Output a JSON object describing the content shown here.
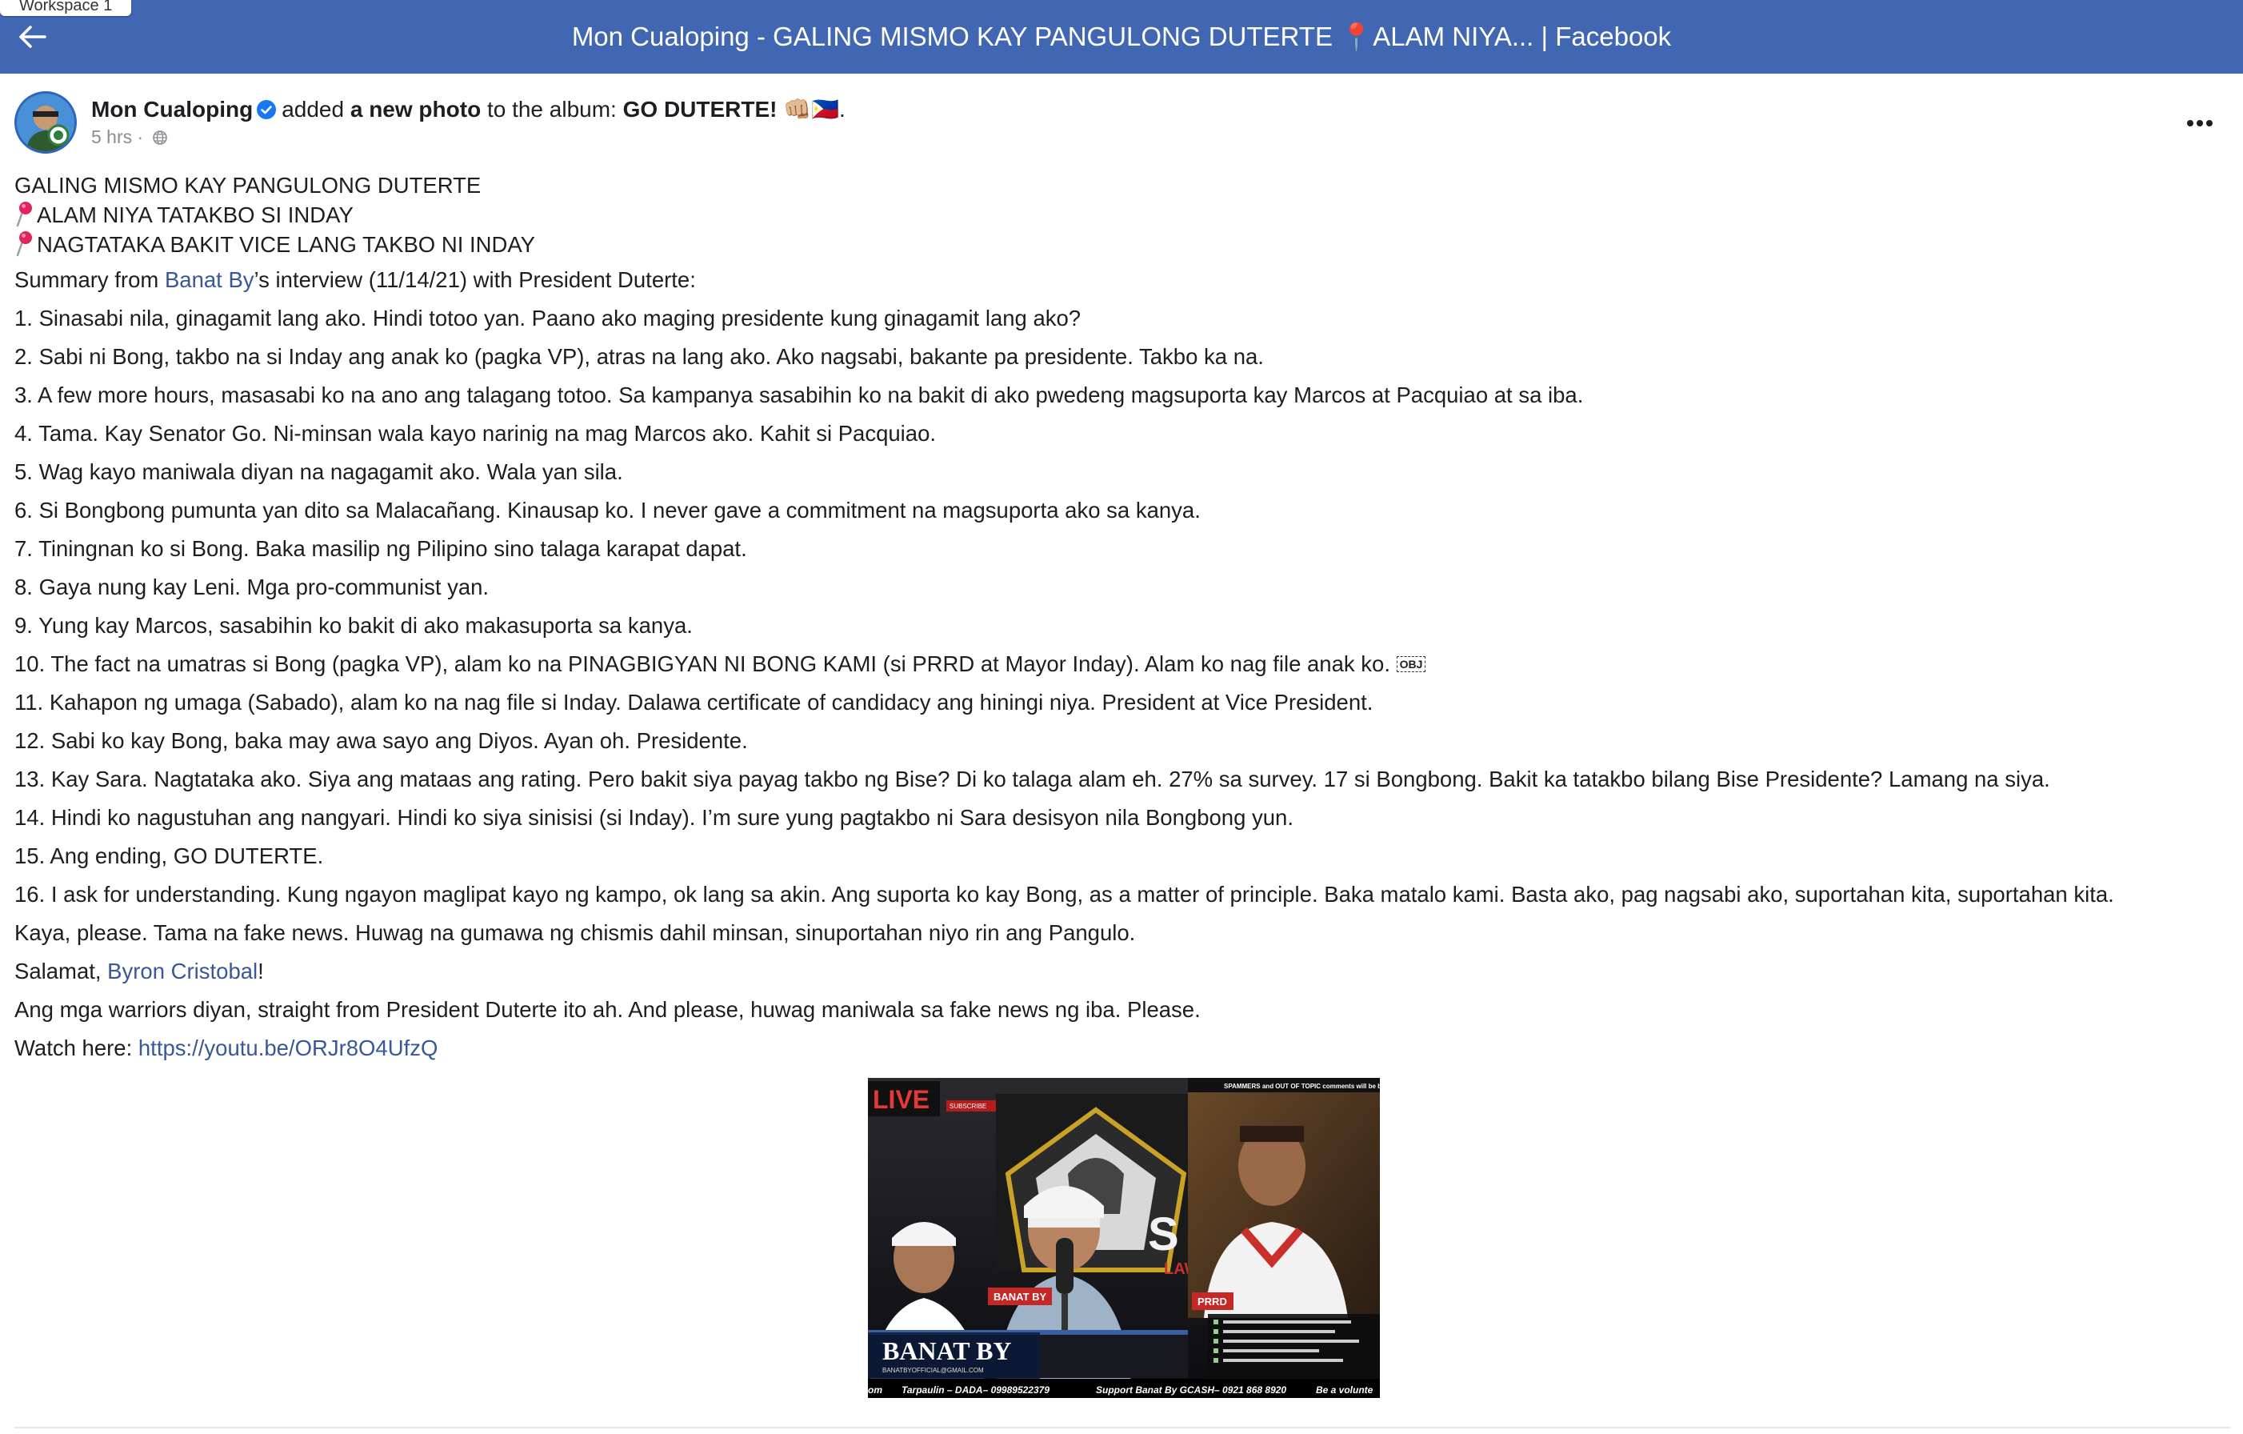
{
  "window": {
    "workspace_label": "Workspace 1",
    "title": "Mon Cualoping - GALING MISMO KAY PANGULONG DUTERTE 📍ALAM NIYA... | Facebook"
  },
  "post": {
    "author": "Mon Cualoping",
    "action_prefix": "added",
    "action_object": "a new photo",
    "action_suffix": "to the album:",
    "album_name": "GO DUTERTE! 👊🏼🇵🇭",
    "album_end": ".",
    "timestamp": "5 hrs",
    "timestamp_sep": "·",
    "headline": "GALING MISMO KAY PANGULONG DUTERTE",
    "pin_lines": [
      "ALAM NIYA TATAKBO SI INDAY",
      "NAGTATAKA BAKIT VICE LANG TAKBO NI INDAY"
    ],
    "summary_prefix": "Summary from ",
    "summary_link": "Banat By",
    "summary_suffix": "’s interview (11/14/21) with President Duterte:",
    "points": [
      "1. Sinasabi nila, ginagamit lang ako. Hindi totoo yan. Paano ako maging presidente kung ginagamit lang ako?",
      "2. Sabi ni Bong, takbo na si Inday ang anak ko (pagka VP), atras na lang ako. Ako nagsabi, bakante pa presidente. Takbo ka na.",
      "3. A few more hours, masasabi ko na ano ang talagang totoo. Sa kampanya sasabihin ko na bakit di ako pwedeng magsuporta kay Marcos at Pacquiao at sa iba.",
      "4. Tama. Kay Senator Go. Ni-minsan wala kayo narinig na mag Marcos ako. Kahit si Pacquiao.",
      "5. Wag kayo maniwala diyan na nagagamit ako. Wala yan sila.",
      "6. Si Bongbong pumunta yan dito sa Malacañang. Kinausap ko. I never gave a commitment na magsuporta ako sa kanya.",
      "7. Tiningnan ko si Bong. Baka masilip ng Pilipino sino talaga karapat dapat.",
      "8. Gaya nung kay Leni. Mga pro-communist yan.",
      "9. Yung kay Marcos, sasabihin ko bakit di ako makasuporta sa kanya.",
      "10. The fact na umatras si Bong (pagka VP), alam ko na PINAGBIGYAN NI BONG KAMI (si PRRD at Mayor Inday). Alam ko nag file anak ko.",
      "11. Kahapon ng umaga (Sabado), alam ko na nag file si Inday. Dalawa certificate of candidacy ang hiningi niya. President at Vice President.",
      "12. Sabi ko kay Bong, baka may awa sayo ang Diyos. Ayan oh. Presidente.",
      "13. Kay Sara. Nagtataka ako. Siya ang mataas ang rating. Pero bakit siya payag takbo ng Bise? Di ko talaga alam eh. 27% sa survey. 17 si Bongbong. Bakit ka tatakbo bilang Bise Presidente? Lamang na siya.",
      "14. Hindi ko nagustuhan ang nangyari. Hindi ko siya sinisisi (si Inday). I’m sure yung pagtakbo ni Sara desisyon nila Bongbong yun.",
      "15. Ang ending, GO DUTERTE.",
      "16. I ask for understanding. Kung ngayon maglipat kayo ng kampo, ok lang sa akin. Ang suporta ko kay Bong, as a matter of principle. Baka matalo kami. Basta ako, pag nagsabi ako, suportahan kita, suportahan kita."
    ],
    "obj_glyph": "OBJ",
    "closing": "Kaya, please. Tama na fake news. Huwag na gumawa ng chismis dahil minsan, sinuportahan niyo rin ang Pangulo.",
    "thanks_prefix": "Salamat, ",
    "thanks_link": "Byron Cristobal",
    "thanks_suffix": "!",
    "warriors": "Ang mga warriors diyan, straight from President Duterte ito ah. And please, huwag maniwala sa fake news ng iba. Please.",
    "watch_prefix": "Watch here: ",
    "watch_link": "https://youtu.be/ORJr8O4UfzQ"
  },
  "photo": {
    "live_badge": "LIVE",
    "subscribe": "SUBSCRIBE",
    "top_notice": "SPAMMERS and OUT OF TOPIC comments will be ban",
    "logo_letters": "S BY",
    "logo_law": "LAW",
    "tag_left": "BANAT BY",
    "tag_right": "PRRD",
    "brand": "BANAT BY",
    "email": "BANATBYOFFICIAL@GMAIL.COM",
    "ticker_left": "om",
    "ticker_mid": "Tarpaulin – DADA– 09989522379",
    "ticker_right": "Support Banat By GCASH– 0921 868 8920",
    "ticker_end": "Be a volunte"
  },
  "colors": {
    "header_bg": "#4267b2",
    "link": "#385898",
    "verified": "#1877f2",
    "pin": "#e0245e"
  },
  "icons": {
    "back": "arrow-left-icon",
    "more": "more-horizontal-icon",
    "verified": "verified-badge-icon",
    "privacy": "globe-icon",
    "pin": "round-pushpin-icon"
  }
}
